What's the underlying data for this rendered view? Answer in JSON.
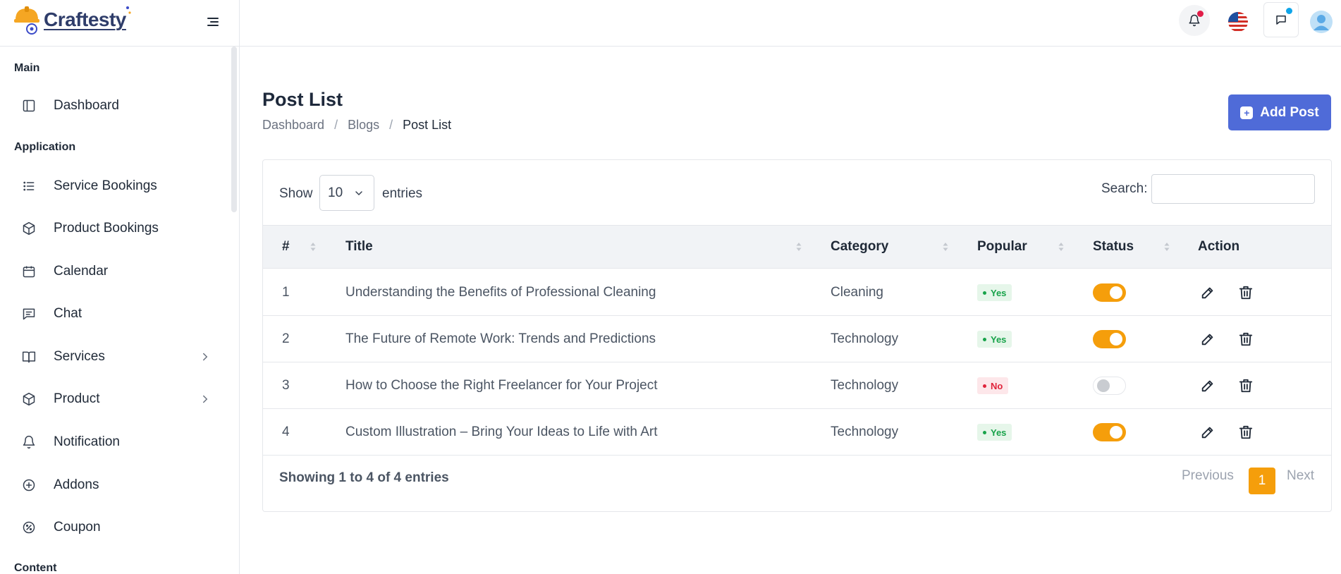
{
  "brand": {
    "name": "Craftesty",
    "accent": "#f59e0b",
    "primary": "#4f6bd8"
  },
  "topbar": {
    "icons": [
      "menu-toggle-icon",
      "bell-icon",
      "us-flag-icon",
      "chat-icon",
      "user-avatar-icon"
    ]
  },
  "sidebar": {
    "sections": {
      "main": "Main",
      "application": "Application",
      "content": "Content"
    },
    "items": [
      {
        "label": "Dashboard",
        "icon": "layout-icon"
      },
      {
        "label": "Service Bookings",
        "icon": "list-icon"
      },
      {
        "label": "Product Bookings",
        "icon": "box-icon"
      },
      {
        "label": "Calendar",
        "icon": "calendar-icon"
      },
      {
        "label": "Chat",
        "icon": "message-icon"
      },
      {
        "label": "Services",
        "icon": "book-icon",
        "has_submenu": true
      },
      {
        "label": "Product",
        "icon": "box-icon",
        "has_submenu": true
      },
      {
        "label": "Notification",
        "icon": "bell-icon"
      },
      {
        "label": "Addons",
        "icon": "plus-circle-icon"
      },
      {
        "label": "Coupon",
        "icon": "percent-icon"
      }
    ]
  },
  "page": {
    "title": "Post List",
    "breadcrumb": [
      "Dashboard",
      "Blogs",
      "Post List"
    ],
    "add_button": "Add Post"
  },
  "table": {
    "show_label": "Show",
    "entries_label": "entries",
    "page_length": "10",
    "search_label": "Search:",
    "search_value": "",
    "columns": [
      "#",
      "Title",
      "Category",
      "Popular",
      "Status",
      "Action"
    ],
    "rows": [
      {
        "num": "1",
        "title": "Understanding the Benefits of Professional Cleaning",
        "category": "Cleaning",
        "popular": "Yes",
        "status": true
      },
      {
        "num": "2",
        "title": "The Future of Remote Work: Trends and Predictions",
        "category": "Technology",
        "popular": "Yes",
        "status": true
      },
      {
        "num": "3",
        "title": "How to Choose the Right Freelancer for Your Project",
        "category": "Technology",
        "popular": "No",
        "status": false
      },
      {
        "num": "4",
        "title": "Custom Illustration – Bring Your Ideas to Life with Art",
        "category": "Technology",
        "popular": "Yes",
        "status": true
      }
    ],
    "info": "Showing 1 to 4 of 4 entries",
    "pagination": {
      "previous": "Previous",
      "current": "1",
      "next": "Next"
    }
  }
}
